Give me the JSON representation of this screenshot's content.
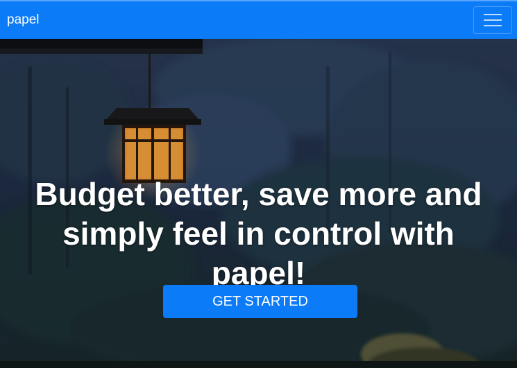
{
  "navbar": {
    "brand": "papel",
    "menu_icon": "hamburger-menu-icon"
  },
  "hero": {
    "headline": "Budget better, save more and simply feel in control with papel!",
    "cta_label": "GET STARTED"
  },
  "colors": {
    "primary": "#0b7bf7",
    "text_light": "#ffffff"
  }
}
